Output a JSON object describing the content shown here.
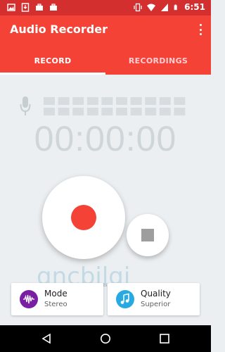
{
  "status_bar": {
    "time": "6:51",
    "left_icons": [
      "image-icon",
      "download-icon",
      "briefcase-icon",
      "briefcase-icon"
    ],
    "right_icons": [
      "vibrate-icon",
      "wifi-icon",
      "signal-icon",
      "battery-icon"
    ]
  },
  "app_bar": {
    "title": "Audio Recorder",
    "tabs": [
      {
        "label": "RECORD",
        "active": true
      },
      {
        "label": "RECORDINGS",
        "active": false
      }
    ]
  },
  "recorder": {
    "timer": "00:00:00",
    "level_meter_bars": 10,
    "level_meter_rows": 2
  },
  "settings_cards": {
    "mode": {
      "title": "Mode",
      "value": "Stereo",
      "icon": "waveform-icon"
    },
    "quality": {
      "title": "Quality",
      "value": "Superior",
      "icon": "music-note-icon"
    }
  },
  "watermark": {
    "text": "gncbilgi",
    "url": "www.gncbilgi.com"
  },
  "colors": {
    "primary": "#f44336",
    "status_bar": "#d32f2f",
    "mode_icon_bg": "#7b1fa2",
    "quality_icon_bg": "#29a9e1"
  }
}
